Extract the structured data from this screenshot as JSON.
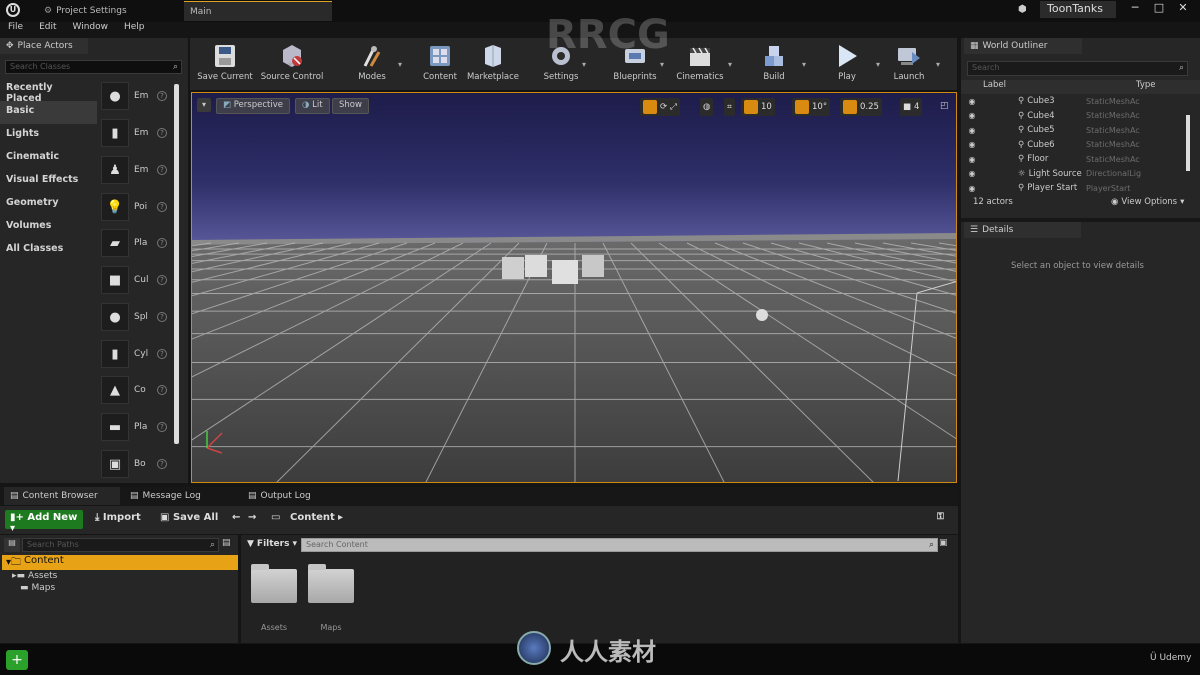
{
  "titlebar": {
    "tabs": [
      {
        "label": "Project Settings"
      },
      {
        "label": "Main"
      }
    ],
    "project_name": "ToonTanks",
    "minimize": "─",
    "maximize": "□",
    "close": "✕"
  },
  "menu": [
    "File",
    "Edit",
    "Window",
    "Help"
  ],
  "place_actors": {
    "tab": "Place Actors",
    "search_placeholder": "Search Classes",
    "categories": [
      "Recently Placed",
      "Basic",
      "Lights",
      "Cinematic",
      "Visual Effects",
      "Geometry",
      "Volumes",
      "All Classes"
    ],
    "selected_category": "Basic",
    "items": [
      "Em",
      "Em",
      "Em",
      "Poi",
      "Pla",
      "Cul",
      "Spl",
      "Cyl",
      "Co",
      "Pla",
      "Bo"
    ]
  },
  "toolbar": {
    "buttons": [
      "Save Current",
      "Source Control",
      "Modes",
      "Content",
      "Marketplace",
      "Settings",
      "Blueprints",
      "Cinematics",
      "Build",
      "Play",
      "Launch"
    ]
  },
  "viewport": {
    "perspective": "Perspective",
    "lit": "Lit",
    "show": "Show",
    "grid_snap": "10",
    "rotation_snap": "10°",
    "scale_snap": "0.25",
    "camera_speed": "4"
  },
  "world_outliner": {
    "tab": "World Outliner",
    "search_placeholder": "Search",
    "col_label": "Label",
    "col_type": "Type",
    "rows": [
      {
        "label": "Cube3",
        "type": "StaticMeshAc"
      },
      {
        "label": "Cube4",
        "type": "StaticMeshAc"
      },
      {
        "label": "Cube5",
        "type": "StaticMeshAc"
      },
      {
        "label": "Cube6",
        "type": "StaticMeshAc"
      },
      {
        "label": "Floor",
        "type": "StaticMeshAc"
      },
      {
        "label": "Light Source",
        "type": "DirectionalLig"
      },
      {
        "label": "Player Start",
        "type": "PlayerStart"
      }
    ],
    "actor_count": "12 actors",
    "view_options": "View Options"
  },
  "details": {
    "tab": "Details",
    "empty_msg": "Select an object to view details"
  },
  "bottom_tabs": [
    "Content Browser",
    "Message Log",
    "Output Log"
  ],
  "content_browser": {
    "add_new": "Add New",
    "import": "Import",
    "save_all": "Save All",
    "path": "Content",
    "filters": "Filters",
    "path_search_placeholder": "Search Paths",
    "content_search_placeholder": "Search Content",
    "tree": [
      "Content",
      "Assets",
      "Maps"
    ],
    "folders": [
      "Assets",
      "Maps"
    ]
  },
  "watermark": {
    "brand": "RRCG",
    "cn": "人人素材",
    "udemy": "Udemy"
  },
  "colors": {
    "accent_orange": "#e0a020",
    "add_green": "#1e7a1e",
    "selection": "#e8a215"
  }
}
